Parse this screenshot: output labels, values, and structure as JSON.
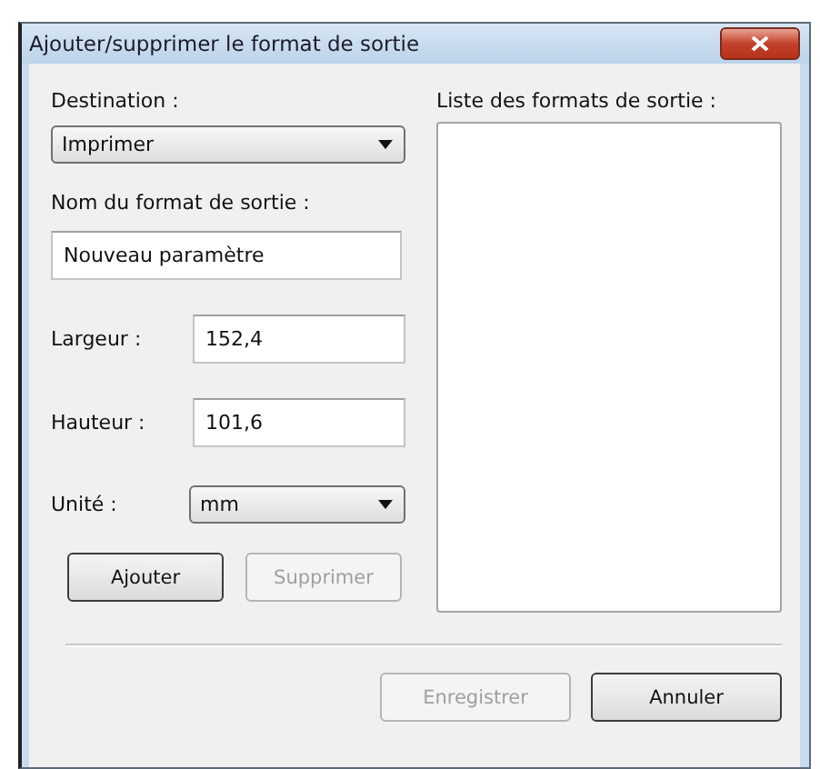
{
  "window": {
    "title": "Ajouter/supprimer le format de sortie"
  },
  "destination": {
    "label": "Destination :",
    "value": "Imprimer"
  },
  "name_field": {
    "label": "Nom du format de sortie :",
    "value": "Nouveau paramètre"
  },
  "fields": [
    {
      "label": "Largeur :",
      "value": "152,4",
      "kind": "text"
    },
    {
      "label": "Hauteur :",
      "value": "101,6",
      "kind": "text"
    },
    {
      "label": "Unité :",
      "value": "mm",
      "kind": "select"
    }
  ],
  "list": {
    "label": "Liste des formats de sortie :"
  },
  "row_buttons": [
    {
      "label": "Ajouter",
      "disabled": false,
      "default": true
    },
    {
      "label": "Supprimer",
      "disabled": true,
      "default": false
    }
  ],
  "footer_buttons": [
    {
      "label": "Enregistrer",
      "disabled": true,
      "default": false
    },
    {
      "label": "Annuler",
      "disabled": false,
      "default": true
    }
  ]
}
